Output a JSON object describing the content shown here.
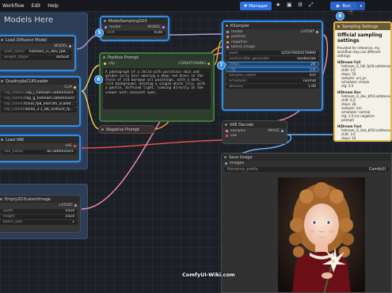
{
  "menubar": {
    "items": [
      "Workflow",
      "Edit",
      "Help"
    ],
    "manager_label": "Manager",
    "run_label": "Run",
    "run_step": "8"
  },
  "group": {
    "title": "Models Here"
  },
  "checkpoint": {
    "title": "Load Diffusion Model",
    "output": "MODEL",
    "widgets": [
      {
        "label": "unet_name",
        "value": "hidream_i1_dev_fp8..."
      },
      {
        "label": "weight_dtype",
        "value": "default"
      }
    ]
  },
  "clip_loader": {
    "title": "QuadrupleCLIPLoader",
    "output": "CLIP",
    "widgets": [
      {
        "label": "clip_name1",
        "value": "clip_l_hidream.safetensors"
      },
      {
        "label": "clip_name2",
        "value": "clip_g_hidream.safetensors"
      },
      {
        "label": "clip_name3",
        "value": "t5xxl_fp8_e4m3fn_scaled..."
      },
      {
        "label": "clip_name4",
        "value": "llama_3.1_8b_instruct_fp..."
      }
    ]
  },
  "vae_loader": {
    "title": "Load VAE",
    "output": "VAE",
    "widgets": [
      {
        "label": "vae_name",
        "value": "ae.safetensors"
      }
    ]
  },
  "latent": {
    "title": "EmptySD3LatentImage",
    "output": "LATENT",
    "widgets": [
      {
        "label": "width",
        "value": "1024"
      },
      {
        "label": "height",
        "value": "1024"
      },
      {
        "label": "batch_size",
        "value": "1"
      }
    ]
  },
  "model_sampling": {
    "badge": "5",
    "title": "ModelSamplingSD3",
    "input": "model",
    "output": "MODEL",
    "widgets": [
      {
        "label": "shift",
        "value": "6.00"
      }
    ]
  },
  "positive_prompt": {
    "badge": "6",
    "title": "Positive Prompt",
    "input": "clip",
    "output": "CONDITIONING",
    "text": "A photograph of a child with porcelain skin and golden curly hair wearing a deep red dress in the style of old baroque oil paintings, with a dark, rich background, holding a single white lily, with a gentle, diffused light, looking directly at the viewer with innocent eyes."
  },
  "negative_prompt": {
    "title": "Negative Prompt"
  },
  "ksampler": {
    "badge": "7",
    "title": "KSampler",
    "inputs": [
      "model",
      "positive",
      "negative",
      "latent_image"
    ],
    "output": "LATENT",
    "widgets": [
      {
        "label": "seed",
        "value": "425070050576890"
      },
      {
        "label": "control after generate",
        "value": "randomize"
      },
      {
        "label": "steps",
        "value": "28"
      },
      {
        "label": "cfg",
        "value": "1.0"
      },
      {
        "label": "sampler_name",
        "value": "lcm"
      },
      {
        "label": "scheduler",
        "value": "normal"
      },
      {
        "label": "denoise",
        "value": "1.00"
      }
    ]
  },
  "vae_decode": {
    "title": "VAE Decode",
    "inputs": [
      "samples",
      "vae"
    ],
    "output": "IMAGE"
  },
  "notes": {
    "title": "Sampling Settings",
    "heading": "Official sampling settings",
    "intro": "Provided for reference, my workflow may use different settings.",
    "sections": [
      {
        "name": "HiDream Full",
        "items": [
          "hidream_i1_full_fp16.safetensors",
          "shift: 3.0",
          "steps: 50",
          "sampler: uni_pc",
          "scheduler: simple",
          "cfg: 5.0"
        ]
      },
      {
        "name": "HiDream Dev",
        "items": [
          "hidream_i1_dev_bf16.safetensors",
          "shift: 6.0",
          "steps: 28",
          "sampler: lcm",
          "scheduler: normal",
          "cfg: 1.0 (no negative prompt)"
        ]
      },
      {
        "name": "HiDream Fast",
        "items": [
          "hidream_i1_fast_bf16.safetensors",
          "shift: 3.0",
          "steps: 16"
        ]
      }
    ]
  },
  "save_image": {
    "title": "Save Image",
    "input": "images",
    "widget_label": "filename_prefix",
    "widget_value": "ComfyUI"
  },
  "watermark": "ComfyUI-Wiki.com",
  "colors": {
    "accent_blue": "#2f8ee6",
    "model_link": "#b39ddb",
    "clip_link": "#ffd54f",
    "vae_link": "#ef5350",
    "latent_link": "#f48fb1",
    "cond_link": "#ffa726",
    "image_link": "#64b5f6",
    "notes_border": "#e3b64a"
  }
}
